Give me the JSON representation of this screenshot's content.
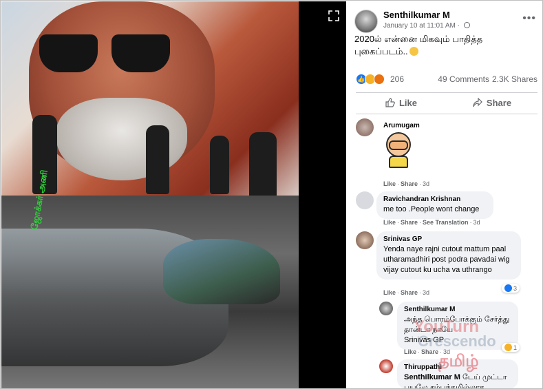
{
  "post": {
    "author": "Senthilkumar M",
    "date": "January 10 at 11:01 AM",
    "privacy_icon": "globe-icon",
    "text": "2020ல் என்னை மிகவும் பாதித்த புகைப்படம்..",
    "photo_watermark": "ஜோக்கர் அணி"
  },
  "stats": {
    "reaction_count": "206",
    "comments": "49 Comments",
    "shares": "2.3K Shares"
  },
  "actions": {
    "like": "Like",
    "share": "Share"
  },
  "comments": [
    {
      "name": "Arumugam",
      "text": "",
      "actions": [
        "Like",
        "Share",
        "3d"
      ]
    },
    {
      "name": "Ravichandran Krishnan",
      "text": "me too .People wont change",
      "actions": [
        "Like",
        "Share",
        "See Translation",
        "3d"
      ]
    },
    {
      "name": "Srinivas GP",
      "text": "Yenda naye rajni cutout mattum paal utharamadhiri post podra pavadai wig vijay cutout ku ucha va uthrango",
      "actions": [
        "Like",
        "Share",
        "3d"
      ],
      "reactions": "3"
    },
    {
      "name": "Senthilkumar M",
      "text": "அந்த பொரம்போக்கும் சேர்த்து தான்டா நாயே",
      "mention": "Srinivas GP",
      "actions": [
        "Like",
        "Share",
        "3d"
      ],
      "reactions": "1"
    },
    {
      "name": "Thiruppathi",
      "mention": "Senthilkumar M",
      "text": "டேய் முட்டா பயலே சம்பந்தமில்லாத"
    }
  ],
  "watermark": {
    "top": "YouTurn",
    "mid": "Crescendo",
    "bottom": "தமிழ்"
  },
  "colors": {
    "accent": "#1877f2",
    "muted": "#65676b",
    "bubble": "#f0f2f5"
  }
}
